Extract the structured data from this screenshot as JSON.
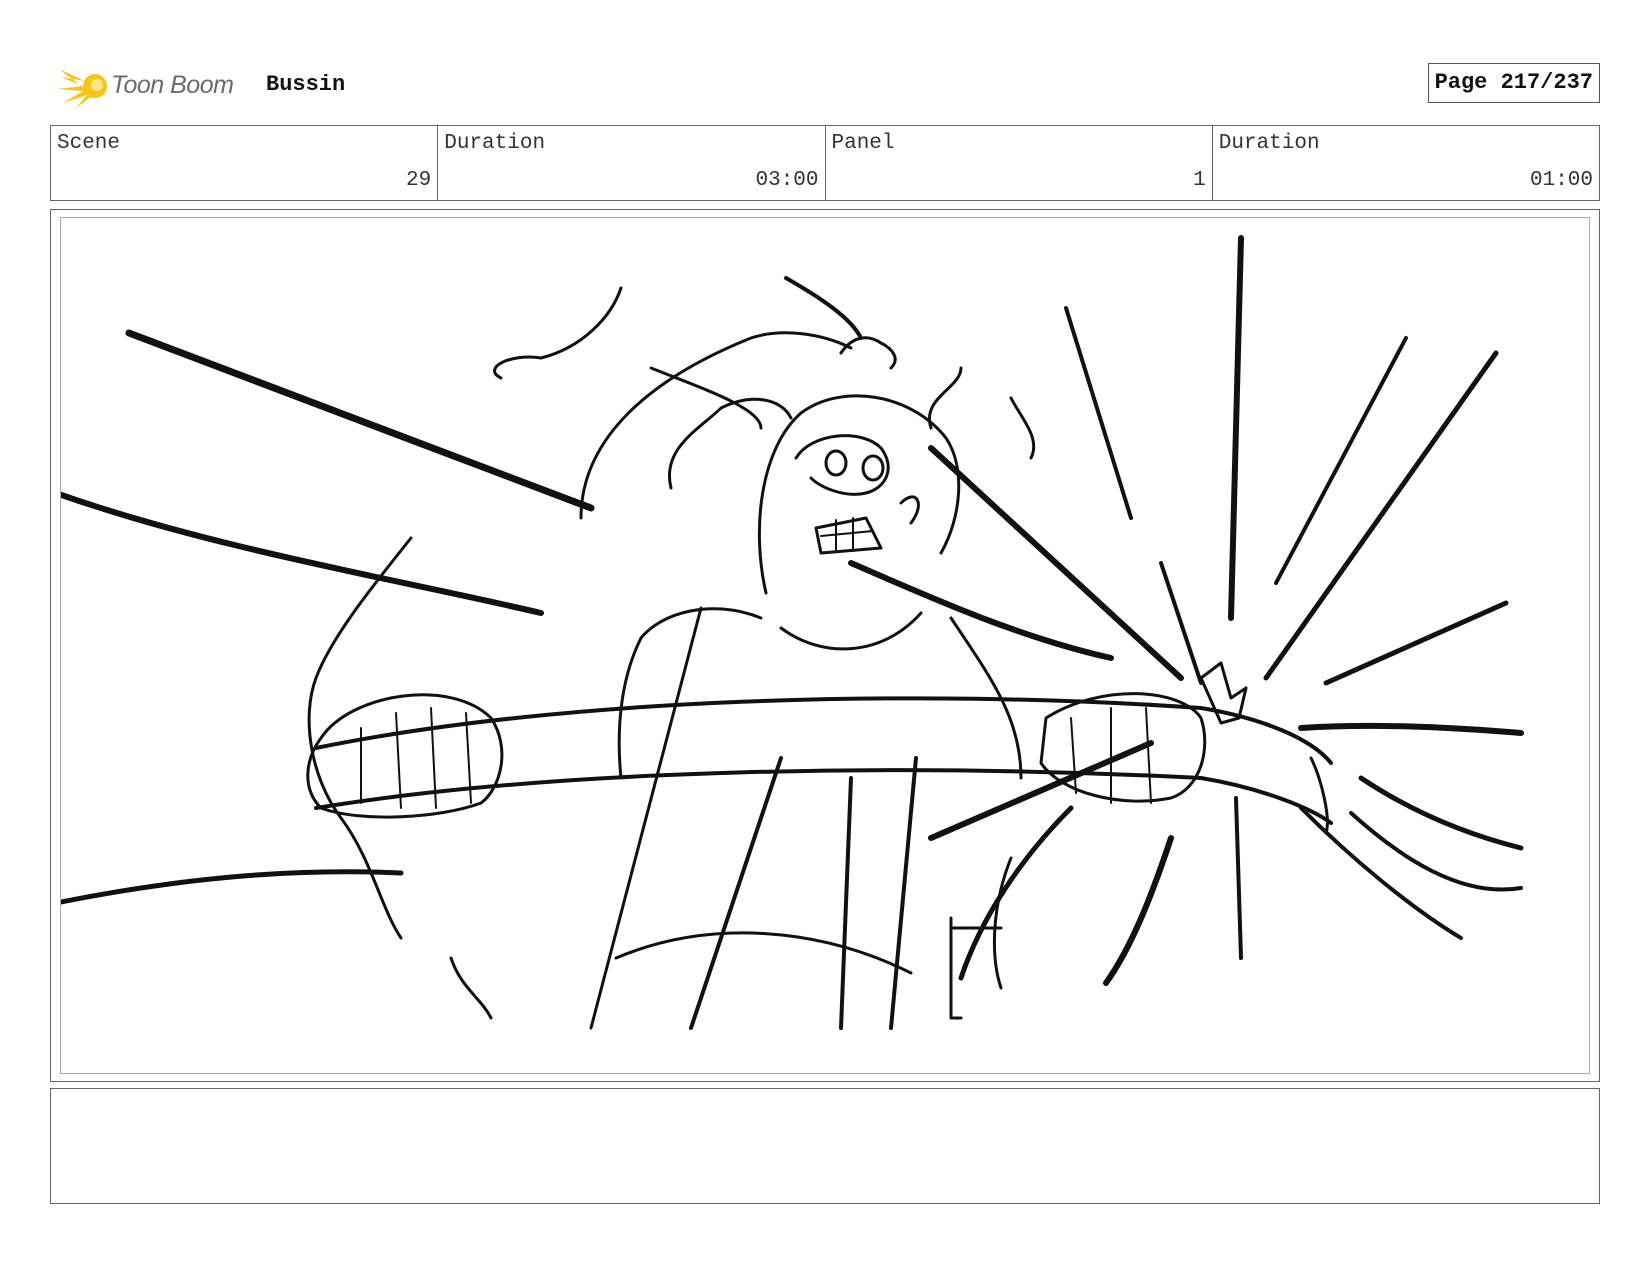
{
  "header": {
    "logo_text": "Toon Boom",
    "project": "Bussin",
    "page": "Page 217/237"
  },
  "info": [
    {
      "label": "Scene",
      "value": "29"
    },
    {
      "label": "Duration",
      "value": "03:00"
    },
    {
      "label": "Panel",
      "value": "1"
    },
    {
      "label": "Duration",
      "value": "01:00"
    }
  ],
  "colors": {
    "logo_accent": "#f5c518",
    "ink": "#111111"
  },
  "notes": ""
}
